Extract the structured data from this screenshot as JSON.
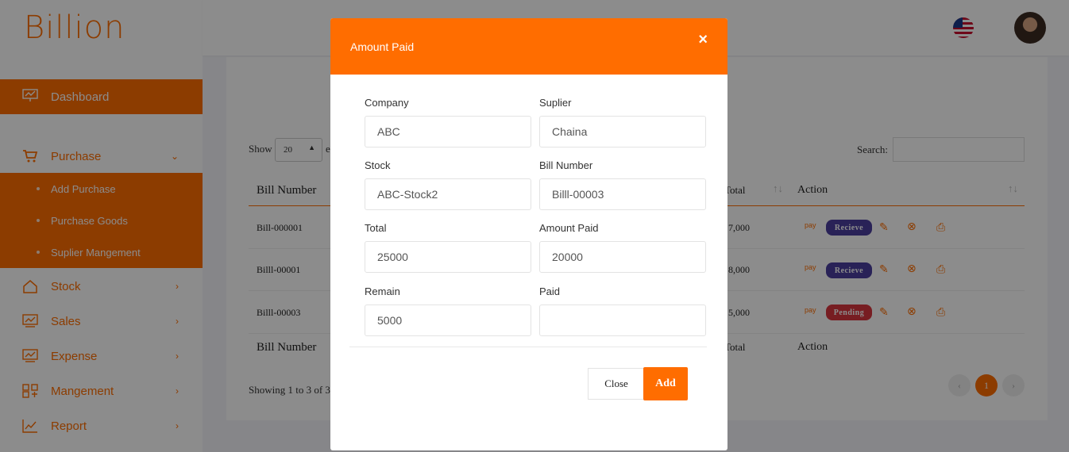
{
  "app": {
    "logo": "Billion"
  },
  "colors": {
    "accent": "#ff6d00",
    "receive": "#4b3f9e",
    "pending": "#d9363e"
  },
  "sidebar": {
    "dashboard": "Dashboard",
    "purchase": "Purchase",
    "purchase_sub": [
      "Add Purchase",
      "Purchase Goods",
      "Suplier Mangement"
    ],
    "items": [
      "Stock",
      "Sales",
      "Expense",
      "Mangement",
      "Report"
    ]
  },
  "table": {
    "show_label": "Show",
    "show_value": "20",
    "show_suffix": "e",
    "search_label": "Search:",
    "headers": {
      "bill": "Bill Number",
      "total": "Total",
      "action": "Action"
    },
    "rows": [
      {
        "bill": "Bill-000001",
        "total": "7,000",
        "status": "Recieve"
      },
      {
        "bill": "Billl-00001",
        "total": "8,000",
        "status": "Recieve"
      },
      {
        "bill": "Billl-00003",
        "total": "5,000",
        "status": "Pending"
      }
    ],
    "showing": "Showing 1 to 3 of 3",
    "page": "1"
  },
  "modal": {
    "title": "Amount Paid",
    "close_icon": "×",
    "fields": {
      "company": {
        "label": "Company",
        "value": "ABC"
      },
      "suplier": {
        "label": "Suplier",
        "value": "Chaina"
      },
      "stock": {
        "label": "Stock",
        "value": "ABC-Stock2"
      },
      "bill_number": {
        "label": "Bill Number",
        "value": "Billl-00003"
      },
      "total": {
        "label": "Total",
        "value": "25000"
      },
      "amount_paid": {
        "label": "Amount Paid",
        "value": "20000"
      },
      "remain": {
        "label": "Remain",
        "value": "5000"
      },
      "paid": {
        "label": "Paid",
        "value": ""
      }
    },
    "close_button": "Close",
    "add_button": "Add"
  }
}
